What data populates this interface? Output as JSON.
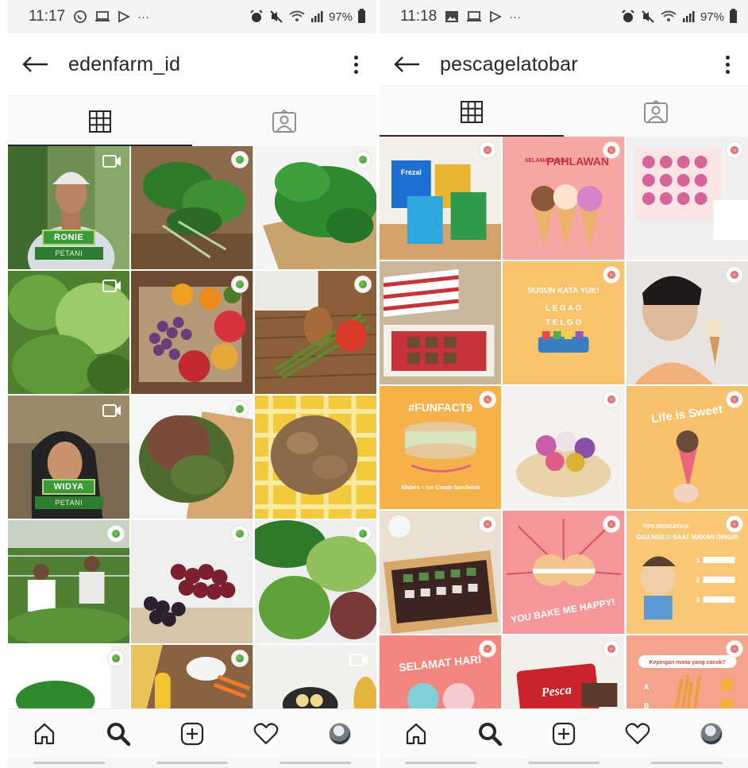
{
  "screens": [
    {
      "status_bar": {
        "time": "11:17",
        "battery": "97%"
      },
      "header": {
        "username": "edenfarm_id"
      },
      "grid": [
        {
          "name_tag": "RONIE",
          "role_tag": "PETANI"
        },
        {},
        {},
        {},
        {},
        {},
        {
          "name_tag": "WIDYA",
          "role_tag": "PETANI"
        },
        {},
        {},
        {},
        {},
        {},
        {},
        {},
        {}
      ]
    },
    {
      "status_bar": {
        "time": "11:18",
        "battery": "97%"
      },
      "header": {
        "username": "pescagelatobar"
      },
      "grid_text": {
        "t1_brand": "Frezal",
        "t2_title_small": "SELAMAT HARI",
        "t2_title": "PAHLAWAN",
        "t5_title": "SUSUN KATA YUK!",
        "t5_row1": "L E G A O",
        "t5_row2": "T E L G O",
        "t7_title": "#FUNFACT9",
        "t7_sub": "Sliders = Ice Cream Sandwich",
        "t9_title": "Life is Sweet",
        "t11_title": "YOU BAKE ME HAPPY!",
        "t12_title_small": "TIPS MENGATASI",
        "t12_title": "GIGI NGILU SAAT MAKAN DINGIN",
        "t12_step1": "1",
        "t12_step2": "2",
        "t12_step3": "3",
        "t13_title": "SELAMAT HARI",
        "t14_brand": "Pesca",
        "t15_title": "Kepingan mana yang cocok?",
        "t15_opt_a": "A",
        "t15_opt_b": "B"
      }
    }
  ],
  "icons": {
    "back": "arrow-left-icon",
    "more": "more-vertical-icon",
    "grid_tab": "grid-icon",
    "tagged_tab": "tagged-person-icon",
    "home": "home-icon",
    "search": "search-icon",
    "add": "add-post-icon",
    "activity": "heart-icon",
    "profile": "avatar"
  }
}
